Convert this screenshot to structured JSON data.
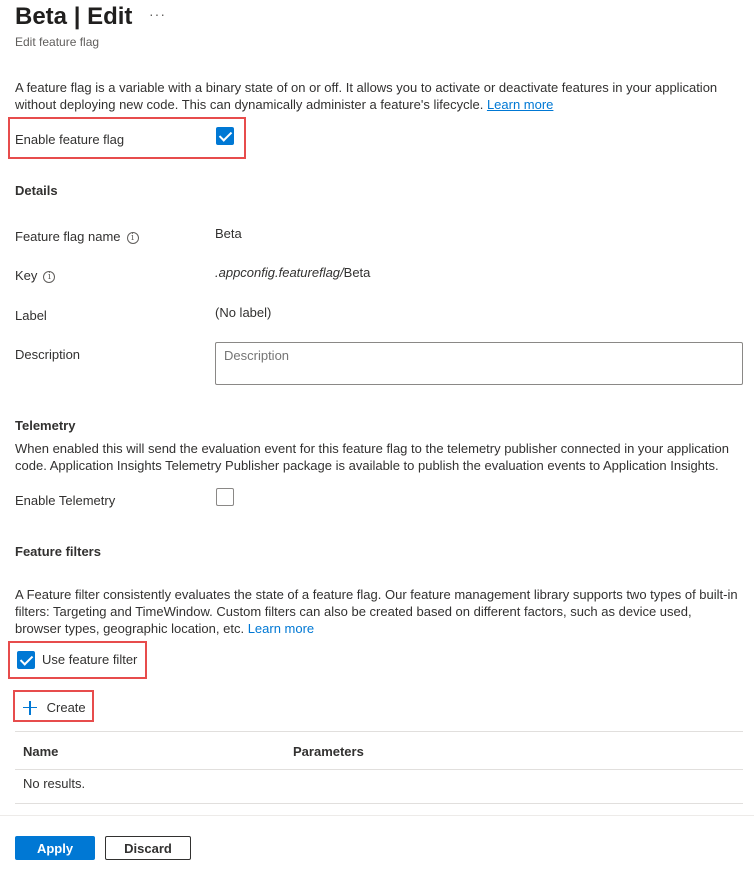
{
  "header": {
    "title": "Beta | Edit",
    "more_label": "···",
    "subtitle": "Edit feature flag"
  },
  "intro": {
    "text": "A feature flag is a variable with a binary state of on or off. It allows you to activate or deactivate features in your application without deploying new code. This can dynamically administer a feature's lifecycle. ",
    "learn_more": "Learn more"
  },
  "enable_flag": {
    "label": "Enable feature flag",
    "checked": true
  },
  "details": {
    "heading": "Details",
    "name_label": "Feature flag name",
    "name_value": "Beta",
    "key_label": "Key",
    "key_prefix": ".appconfig.featureflag/",
    "key_suffix": "Beta",
    "label_label": "Label",
    "label_value": "(No label)",
    "description_label": "Description",
    "description_placeholder": "Description"
  },
  "telemetry": {
    "heading": "Telemetry",
    "text": "When enabled this will send the evaluation event for this feature flag to the telemetry publisher connected in your application code. Application Insights Telemetry Publisher package is available to publish the evaluation events to Application Insights.",
    "enable_label": "Enable Telemetry",
    "checked": false
  },
  "filters": {
    "heading": "Feature filters",
    "text": "A Feature filter consistently evaluates the state of a feature flag. Our feature management library supports two types of built-in filters: Targeting and TimeWindow. Custom filters can also be created based on different factors, such as device used, browser types, geographic location, etc. ",
    "learn_more": "Learn more",
    "use_filter_label": "Use feature filter",
    "use_filter_checked": true,
    "create_label": "Create",
    "columns": [
      "Name",
      "Parameters"
    ],
    "empty_text": "No results."
  },
  "footer": {
    "apply_label": "Apply",
    "discard_label": "Discard"
  },
  "colors": {
    "accent": "#0078d4",
    "highlight_border": "#e74c4c"
  }
}
